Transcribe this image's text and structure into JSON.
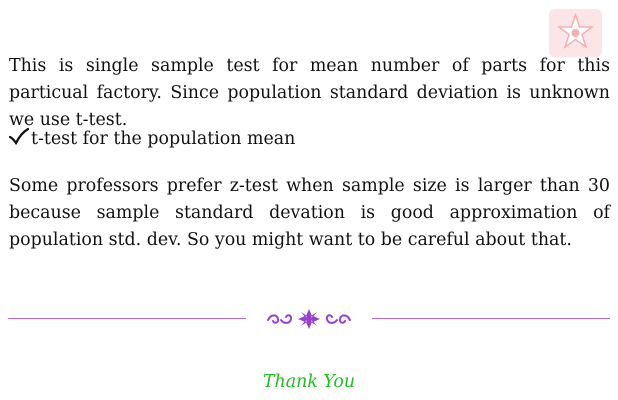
{
  "document": {
    "paragraph_1": "This is single sample test for mean number of parts for this particual factory. Since population standard deviation is unknown we use t-test.",
    "check_item": "t-test for the population mean",
    "paragraph_2": "Some professors prefer z-test when sample size is larger than 30 because sample standard devation is good approximation of population std. dev. So you might want to be careful about that.",
    "closing": "Thank You"
  },
  "colors": {
    "divider": "#b36ae2",
    "closing_text": "#1fbf1f",
    "logo": "#f3a7a9"
  },
  "icons": [
    "logo-icon",
    "checkmark-icon",
    "ornament-icon"
  ]
}
